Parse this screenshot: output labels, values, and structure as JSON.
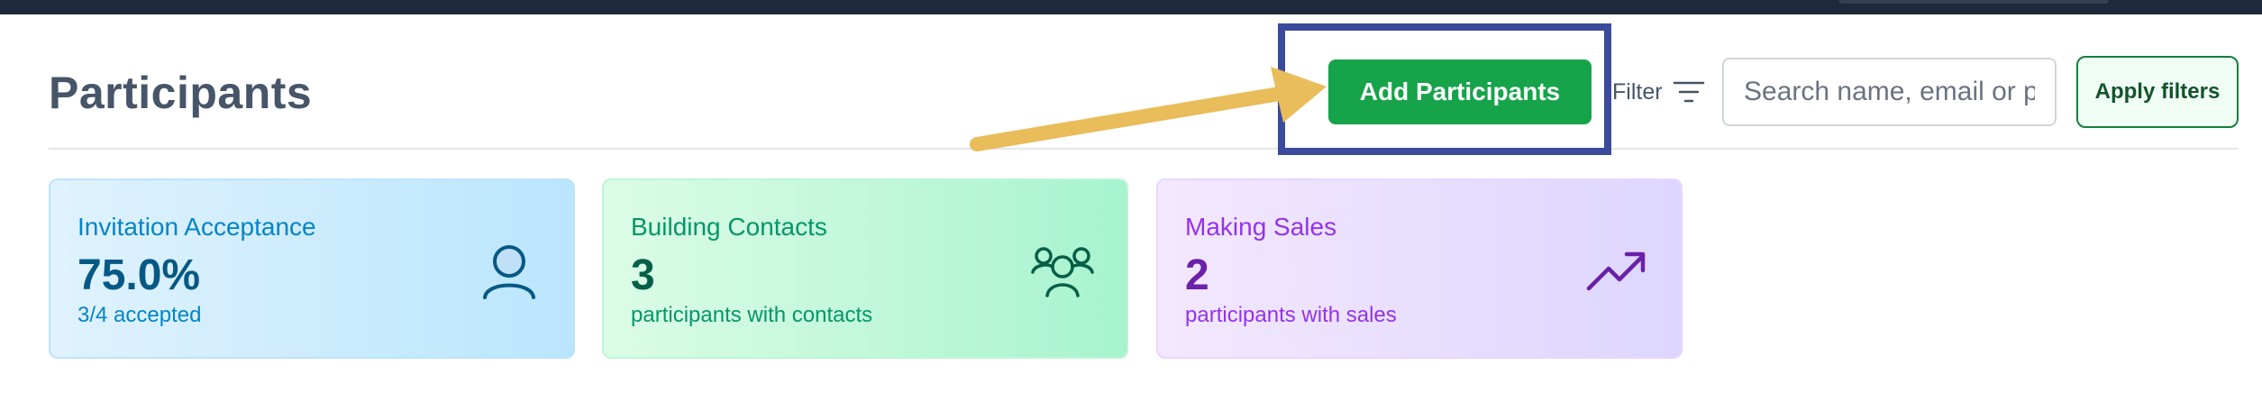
{
  "header": {
    "title": "Participants",
    "add_button_label": "Add Participants",
    "filter_label": "Filter",
    "search_placeholder": "Search name, email or p",
    "apply_filters_label": "Apply filters"
  },
  "annotation": {
    "highlight_color": "#3c4a9c",
    "arrow_color": "#e8bd5a"
  },
  "stats": [
    {
      "title": "Invitation Acceptance",
      "value": "75.0%",
      "subtitle": "3/4 accepted",
      "icon": "user-icon",
      "accent": "#0284c7"
    },
    {
      "title": "Building Contacts",
      "value": "3",
      "subtitle": "participants with contacts",
      "icon": "users-group-icon",
      "accent": "#059669"
    },
    {
      "title": "Making Sales",
      "value": "2",
      "subtitle": "participants with sales",
      "icon": "trending-up-icon",
      "accent": "#9333ea"
    }
  ]
}
